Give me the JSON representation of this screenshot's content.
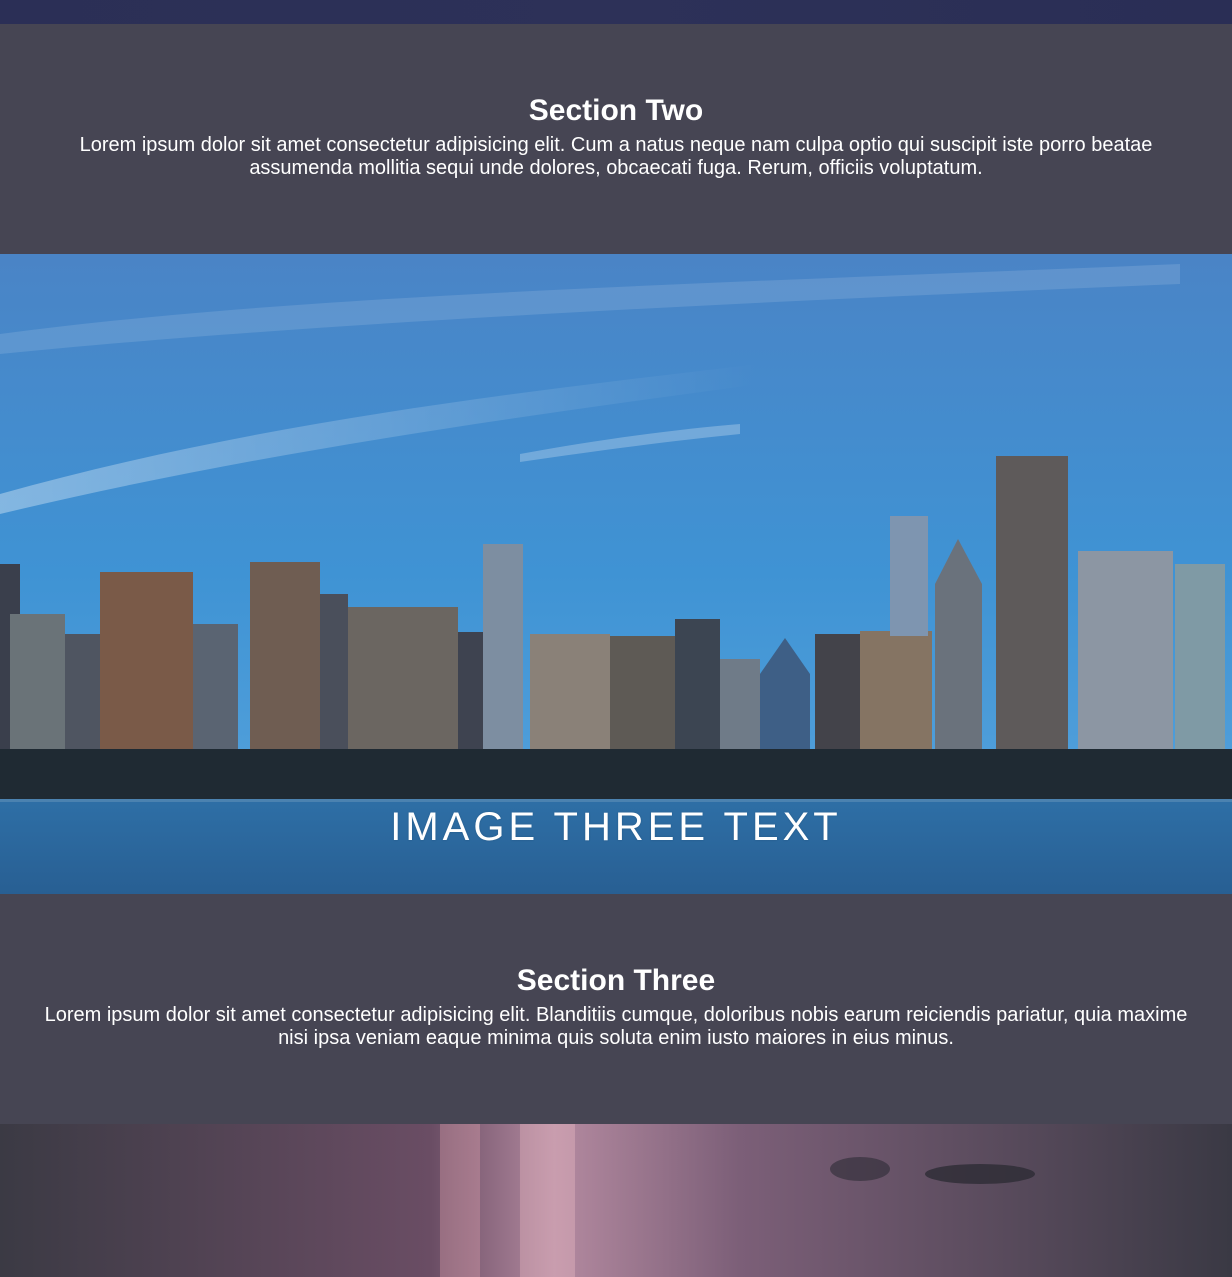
{
  "section_two": {
    "heading": "Section Two",
    "body": "Lorem ipsum dolor sit amet consectetur adipisicing elit. Cum a natus neque nam culpa optio qui suscipit iste porro beatae assumenda mollitia sequi unde dolores, obcaecati fuga. Rerum, officiis voluptatum."
  },
  "image_three": {
    "text": "IMAGE THREE TEXT",
    "subject": "city-skyline-photo"
  },
  "section_three": {
    "heading": "Section Three",
    "body": "Lorem ipsum dolor sit amet consectetur adipisicing elit. Blanditiis cumque, doloribus nobis earum reiciendis pariatur, quia maxime nisi ipsa veniam eaque minima quis soluta enim iusto maiores in eius minus."
  },
  "image_four": {
    "subject": "wet-road-reflection-photo"
  },
  "colors": {
    "top_strip": "#2b2f56",
    "section_bg": "#464553",
    "text": "#ffffff",
    "sky_top": "#4a86c9",
    "sky_bottom": "#3f95d6",
    "water": "#2f6ea3"
  }
}
